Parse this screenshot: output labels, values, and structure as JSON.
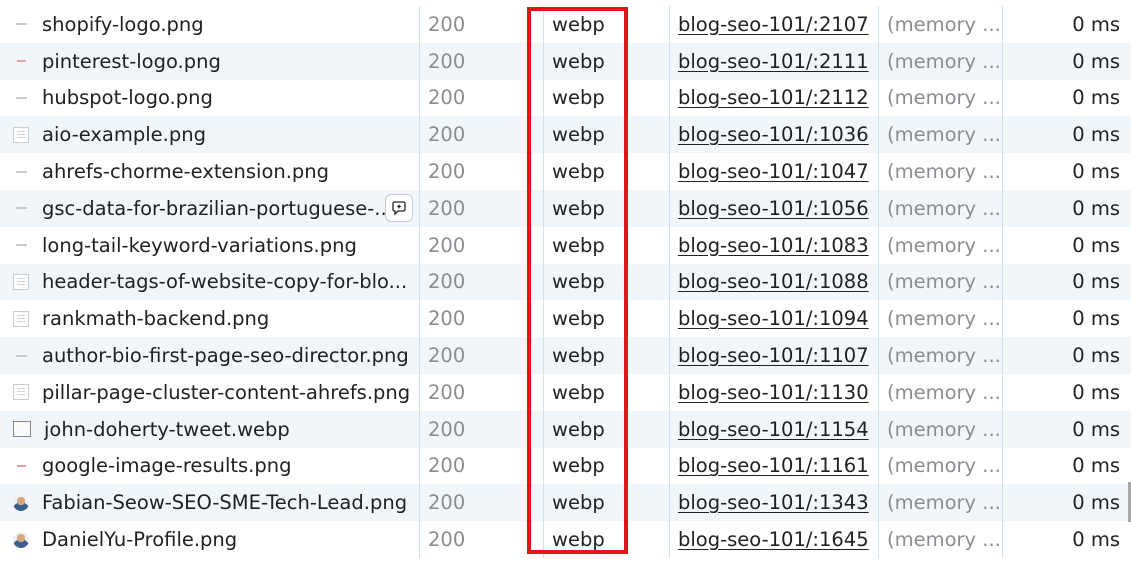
{
  "rows": [
    {
      "name": "shopify-logo.png",
      "status": "200",
      "type": "webp",
      "initiator": "blog-seo-101/:2107",
      "size": "(memory ...",
      "time": "0 ms",
      "thumb": "line"
    },
    {
      "name": "pinterest-logo.png",
      "status": "200",
      "type": "webp",
      "initiator": "blog-seo-101/:2111",
      "size": "(memory ...",
      "time": "0 ms",
      "thumb": "red"
    },
    {
      "name": "hubspot-logo.png",
      "status": "200",
      "type": "webp",
      "initiator": "blog-seo-101/:2112",
      "size": "(memory ...",
      "time": "0 ms",
      "thumb": "line"
    },
    {
      "name": "aio-example.png",
      "status": "200",
      "type": "webp",
      "initiator": "blog-seo-101/:1036",
      "size": "(memory ...",
      "time": "0 ms",
      "thumb": "doc"
    },
    {
      "name": "ahrefs-chorme-extension.png",
      "status": "200",
      "type": "webp",
      "initiator": "blog-seo-101/:1047",
      "size": "(memory ...",
      "time": "0 ms",
      "thumb": "line"
    },
    {
      "name": "gsc-data-for-brazilian-portuguese-...",
      "status": "200",
      "type": "webp",
      "initiator": "blog-seo-101/:1056",
      "size": "(memory ...",
      "time": "0 ms",
      "thumb": "line",
      "hover": true
    },
    {
      "name": "long-tail-keyword-variations.png",
      "status": "200",
      "type": "webp",
      "initiator": "blog-seo-101/:1083",
      "size": "(memory ...",
      "time": "0 ms",
      "thumb": "line"
    },
    {
      "name": "header-tags-of-website-copy-for-blo...",
      "status": "200",
      "type": "webp",
      "initiator": "blog-seo-101/:1088",
      "size": "(memory ...",
      "time": "0 ms",
      "thumb": "doc"
    },
    {
      "name": "rankmath-backend.png",
      "status": "200",
      "type": "webp",
      "initiator": "blog-seo-101/:1094",
      "size": "(memory ...",
      "time": "0 ms",
      "thumb": "doc"
    },
    {
      "name": "author-bio-first-page-seo-director.png",
      "status": "200",
      "type": "webp",
      "initiator": "blog-seo-101/:1107",
      "size": "(memory ...",
      "time": "0 ms",
      "thumb": "line"
    },
    {
      "name": "pillar-page-cluster-content-ahrefs.png",
      "status": "200",
      "type": "webp",
      "initiator": "blog-seo-101/:1130",
      "size": "(memory ...",
      "time": "0 ms",
      "thumb": "doc"
    },
    {
      "name": "john-doherty-tweet.webp",
      "status": "200",
      "type": "webp",
      "initiator": "blog-seo-101/:1154",
      "size": "(memory ...",
      "time": "0 ms",
      "thumb": "frame"
    },
    {
      "name": "google-image-results.png",
      "status": "200",
      "type": "webp",
      "initiator": "blog-seo-101/:1161",
      "size": "(memory ...",
      "time": "0 ms",
      "thumb": "red"
    },
    {
      "name": "Fabian-Seow-SEO-SME-Tech-Lead.png",
      "status": "200",
      "type": "webp",
      "initiator": "blog-seo-101/:1343",
      "size": "(memory ...",
      "time": "0 ms",
      "thumb": "face"
    },
    {
      "name": "DanielYu-Profile.png",
      "status": "200",
      "type": "webp",
      "initiator": "blog-seo-101/:1645",
      "size": "(memory ...",
      "time": "0 ms",
      "thumb": "face"
    }
  ],
  "colors": {
    "highlight": "#e2151b",
    "stripe": "#f1f6fa",
    "divider": "#cfe3ef"
  }
}
